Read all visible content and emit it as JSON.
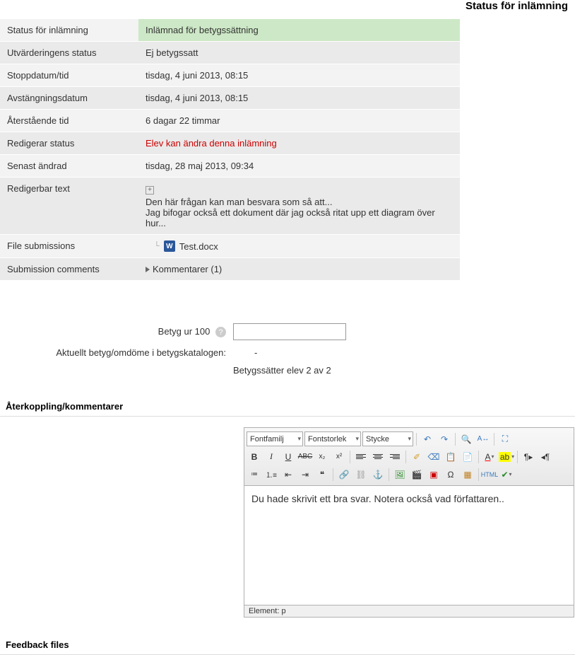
{
  "page_title": "Status för inlämning",
  "rows": {
    "submission_status": {
      "label": "Status för inlämning",
      "value": "Inlämnad för betygssättning"
    },
    "grading_status": {
      "label": "Utvärderingens status",
      "value": "Ej betygssatt"
    },
    "due_date": {
      "label": "Stoppdatum/tid",
      "value": "tisdag, 4 juni 2013, 08:15"
    },
    "cutoff_date": {
      "label": "Avstängningsdatum",
      "value": "tisdag, 4 juni 2013, 08:15"
    },
    "time_remaining": {
      "label": "Återstående tid",
      "value": "6 dagar 22 timmar"
    },
    "editing_status": {
      "label": "Redigerar status",
      "value": "Elev kan ändra denna inlämning"
    },
    "last_modified": {
      "label": "Senast ändrad",
      "value": "tisdag, 28 maj 2013, 09:34"
    },
    "online_text": {
      "label": "Redigerbar text",
      "line1": "Den här frågan kan man besvara som så att...",
      "line2": "Jag bifogar också ett dokument där jag också ritat upp ett diagram över hur..."
    },
    "file_submissions": {
      "label": "File submissions",
      "file": "Test.docx"
    },
    "submission_comments": {
      "label": "Submission comments",
      "value": "Kommentarer (1)"
    }
  },
  "grade": {
    "out_of_label": "Betyg ur 100",
    "gradebook_label": "Aktuellt betyg/omdöme i betygskatalogen:",
    "gradebook_value": "-",
    "progress": "Betygssätter elev 2 av 2"
  },
  "feedback_section_title": "Återkoppling/kommentarer",
  "feedback_files_title": "Feedback files",
  "editor": {
    "font_family": "Fontfamilj",
    "font_size": "Fontstorlek",
    "paragraph": "Stycke",
    "html_label": "HTML",
    "content": "Du hade skrivit ett bra svar. Notera också vad författaren..",
    "path": "Element: p"
  },
  "icons": {
    "word": "W",
    "help": "?",
    "expand": "+"
  }
}
